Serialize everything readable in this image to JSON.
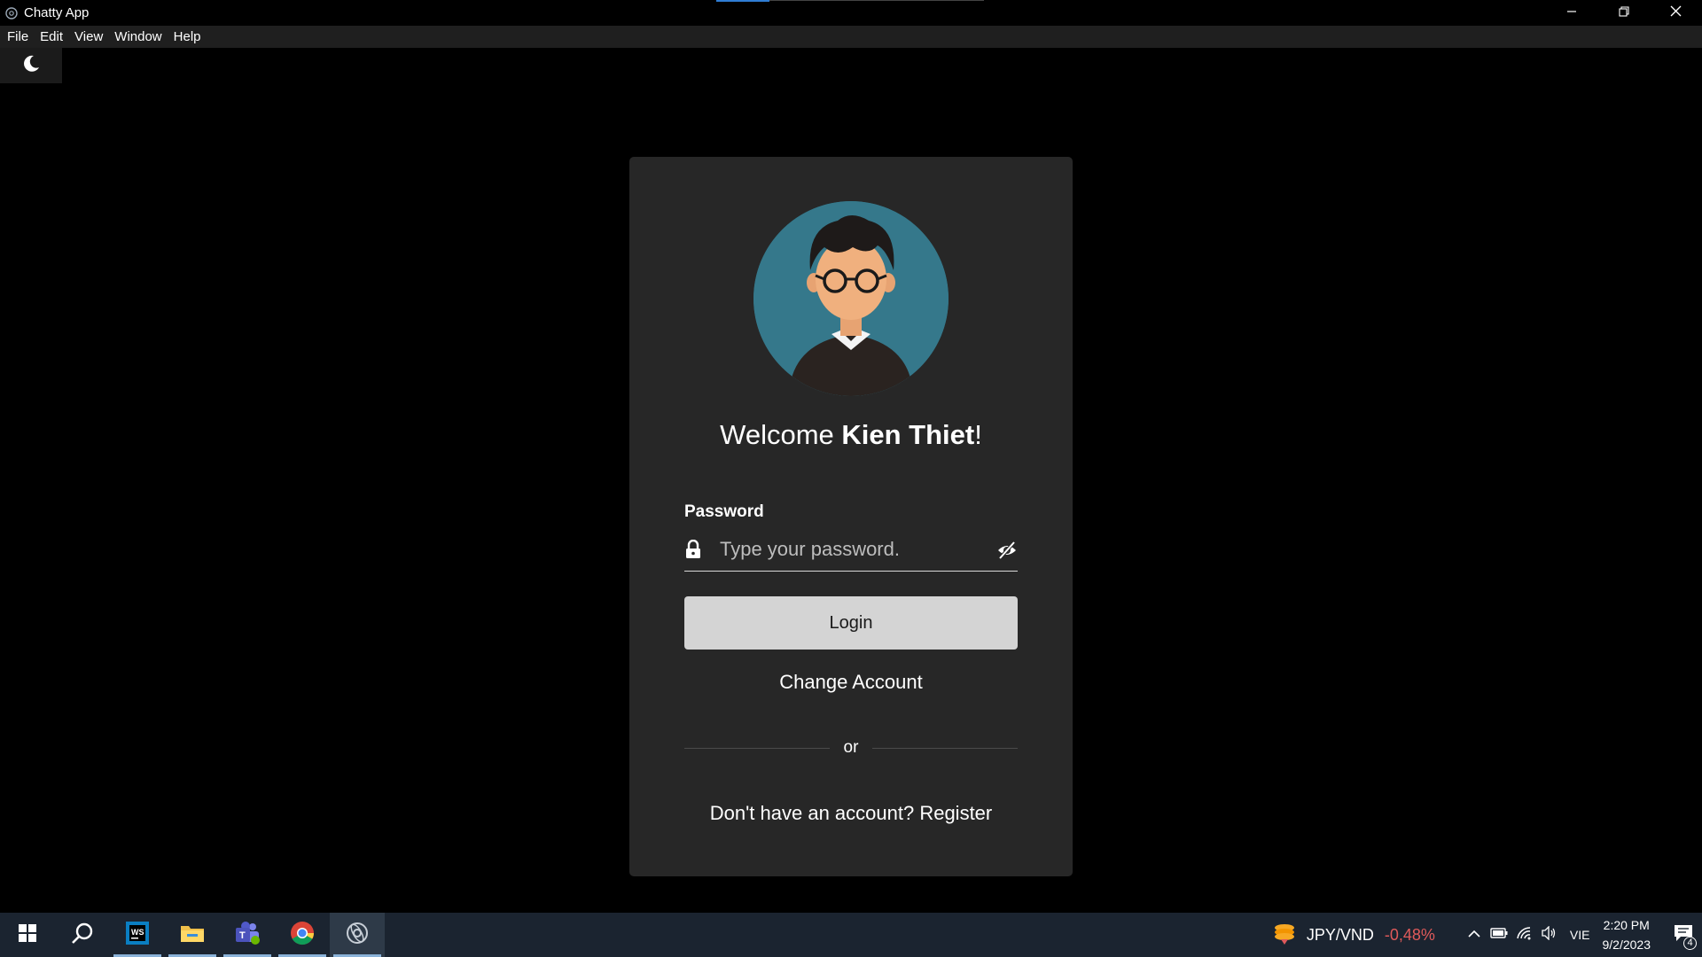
{
  "window": {
    "title": "Chatty App",
    "controls": [
      "minimize-icon",
      "restore-icon",
      "close-icon"
    ]
  },
  "menu": {
    "items": [
      "File",
      "Edit",
      "View",
      "Window",
      "Help"
    ]
  },
  "theme_toggle": {
    "icon": "moon-icon"
  },
  "login": {
    "welcome_prefix": "Welcome ",
    "user_name": "Kien Thiet",
    "welcome_suffix": "!",
    "password_label": "Password",
    "password_placeholder": "Type your password.",
    "password_value": "",
    "login_label": "Login",
    "change_account_label": "Change Account",
    "divider_text": "or",
    "register_text": "Don't have an account? Register"
  },
  "taskbar": {
    "apps": [
      "windows-start-icon",
      "search-icon",
      "webstorm-icon",
      "file-explorer-icon",
      "teams-icon",
      "chrome-icon",
      "chatty-app-icon"
    ],
    "fx_pair": "JPY/VND",
    "fx_change": "-0,48%",
    "language": "VIE",
    "time": "2:20 PM",
    "date": "9/2/2023",
    "notification_count": "4"
  },
  "colors": {
    "card_bg": "#272727",
    "avatar_bg": "#35788b",
    "login_button_bg": "#d4d4d4",
    "fx_negative": "#e05a5a",
    "taskbar_bg": "#1b2430"
  }
}
